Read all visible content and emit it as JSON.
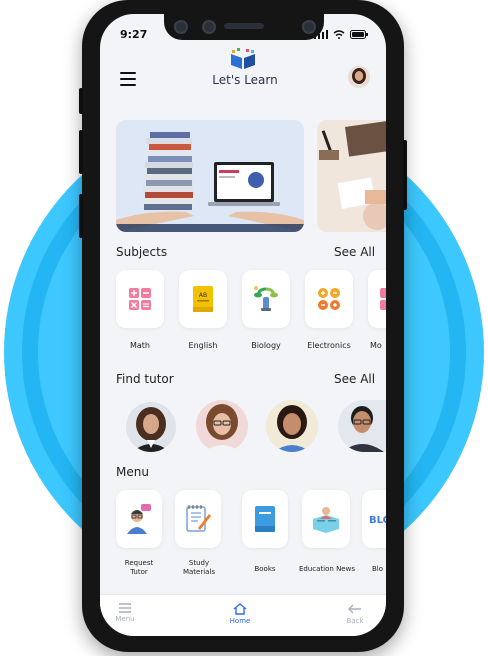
{
  "status": {
    "time": "9:27"
  },
  "app": {
    "title": "Let's Learn"
  },
  "sections": {
    "subjects": {
      "title": "Subjects",
      "see_all": "See All"
    },
    "tutors": {
      "title": "Find tutor",
      "see_all": "See All"
    },
    "menu": {
      "title": "Menu"
    }
  },
  "subjects": [
    {
      "label": "Math",
      "icon": "math-icon"
    },
    {
      "label": "English",
      "icon": "english-book-icon"
    },
    {
      "label": "Biology",
      "icon": "biology-icon"
    },
    {
      "label": "Electronics",
      "icon": "electronics-icon"
    },
    {
      "label": "Mo",
      "icon": "math-icon"
    }
  ],
  "menu_items": [
    {
      "label": "Request\nTutor",
      "icon": "tutor-request-icon"
    },
    {
      "label": "Study\nMaterials",
      "icon": "study-materials-icon"
    },
    {
      "label": "Books",
      "icon": "book-icon"
    },
    {
      "label": "Education News",
      "icon": "news-icon"
    },
    {
      "label": "Blo",
      "icon": "blog-icon"
    }
  ],
  "bottom_nav": {
    "menu": "Menu",
    "home": "Home",
    "back": "Back"
  },
  "colors": {
    "accent": "#2e6df0",
    "ring": "#3cc7ff",
    "screen_bg": "#f3f4f8"
  }
}
